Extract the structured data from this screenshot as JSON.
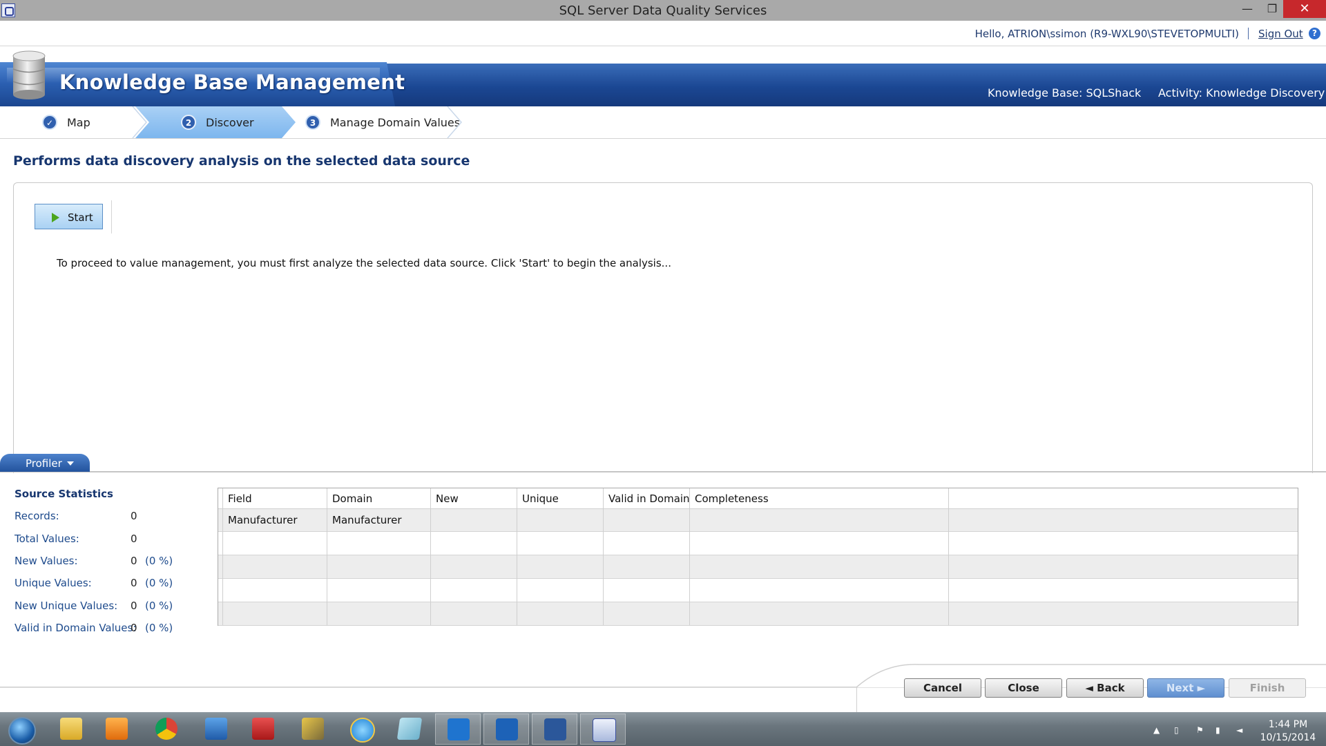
{
  "window": {
    "title": "SQL Server Data Quality Services",
    "controls": {
      "minimize": "—",
      "maximize": "❐",
      "close": "✕"
    }
  },
  "userbar": {
    "greeting": "Hello, ATRION\\ssimon (R9-WXL90\\STEVETOPMULTI)",
    "signout": "Sign Out",
    "help": "?"
  },
  "banner": {
    "title": "Knowledge Base Management",
    "knowledge_base": "Knowledge Base: SQLShack",
    "activity": "Activity: Knowledge Discovery"
  },
  "steps": [
    {
      "number": "✓",
      "label": "Map",
      "state": "done"
    },
    {
      "number": "2",
      "label": "Discover",
      "state": "active"
    },
    {
      "number": "3",
      "label": "Manage Domain Values",
      "state": "pending"
    }
  ],
  "main": {
    "heading": "Performs data discovery analysis on the selected data source",
    "start_label": "Start",
    "instruction": "To proceed to value management, you must first analyze the selected data source. Click 'Start' to begin the analysis..."
  },
  "profiler": {
    "tab_label": "Profiler",
    "stats_title": "Source Statistics",
    "stats": [
      {
        "label": "Records:",
        "value": "0",
        "pct": ""
      },
      {
        "label": "Total Values:",
        "value": "0",
        "pct": ""
      },
      {
        "label": "New Values:",
        "value": "0",
        "pct": "(0 %)"
      },
      {
        "label": "Unique Values:",
        "value": "0",
        "pct": "(0 %)"
      },
      {
        "label": "New Unique Values:",
        "value": "0",
        "pct": "(0 %)"
      },
      {
        "label": "Valid in Domain Values:",
        "value": "0",
        "pct": "(0 %)"
      }
    ],
    "grid": {
      "columns": [
        "Field",
        "Domain",
        "New",
        "Unique",
        "Valid in Domain",
        "Completeness"
      ],
      "rows": [
        [
          "Manufacturer",
          "Manufacturer",
          "",
          "",
          "",
          ""
        ],
        [
          "",
          "",
          "",
          "",
          "",
          ""
        ],
        [
          "",
          "",
          "",
          "",
          "",
          ""
        ],
        [
          "",
          "",
          "",
          "",
          "",
          ""
        ],
        [
          "",
          "",
          "",
          "",
          "",
          ""
        ]
      ]
    }
  },
  "nav": {
    "cancel": "Cancel",
    "close": "Close",
    "back": "◄  Back",
    "next": "Next  ►",
    "finish": "Finish"
  },
  "taskbar": {
    "items": [
      "start-orb",
      "file-explorer",
      "media-player",
      "chrome",
      "remote-desktop",
      "toolbox",
      "network-tools",
      "internet-explorer",
      "notepad",
      "lync",
      "outlook",
      "word",
      "data-quality-client"
    ],
    "time": "1:44 PM",
    "date": "10/15/2014"
  }
}
